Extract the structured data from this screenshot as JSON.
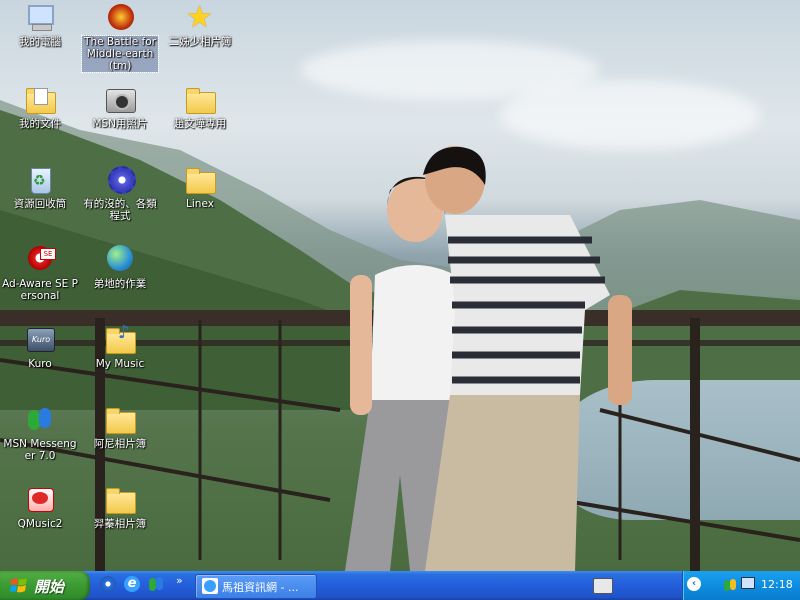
{
  "desktop": {
    "icons": [
      {
        "label": "我的電腦",
        "icon": "my-computer-icon"
      },
      {
        "label": "The Battle for Middle-earth (tm)",
        "icon": "battle-middle-earth-icon"
      },
      {
        "label": "二姊少相片簿",
        "icon": "star-icon"
      },
      {
        "label": "我的文件",
        "icon": "my-documents-icon"
      },
      {
        "label": "MSN用照片",
        "icon": "camera-icon"
      },
      {
        "label": "趙文嘩專用",
        "icon": "folder-icon"
      },
      {
        "label": "資源回收筒",
        "icon": "recycle-bin-icon"
      },
      {
        "label": "有的沒的、各類程式",
        "icon": "gear-icon"
      },
      {
        "label": "Linex",
        "icon": "folder-icon"
      },
      {
        "label": "Ad-Aware SE Personal",
        "icon": "ad-aware-icon"
      },
      {
        "label": "弟地的作業",
        "icon": "globe-icon"
      },
      {
        "label": "Kuro",
        "icon": "kuro-icon"
      },
      {
        "label": "My Music",
        "icon": "music-folder-icon"
      },
      {
        "label": "MSN Messenger 7.0",
        "icon": "msn-messenger-icon"
      },
      {
        "label": "阿尼相片簿",
        "icon": "folder-icon"
      },
      {
        "label": "QMusic2",
        "icon": "qmusic-icon"
      },
      {
        "label": "羿蓁相片簿",
        "icon": "folder-icon"
      }
    ]
  },
  "taskbar": {
    "start_label": "開始",
    "quick_launch": [
      "media-icon",
      "ie-icon",
      "msn-icon"
    ],
    "overflow": "»",
    "task_button": {
      "label": "馬祖資訊網 - ...",
      "icon": "ie-window-icon"
    },
    "tray": {
      "icons": [
        "volume-icon",
        "network-icon",
        "monitor-icon"
      ],
      "clock": "12:18"
    }
  }
}
